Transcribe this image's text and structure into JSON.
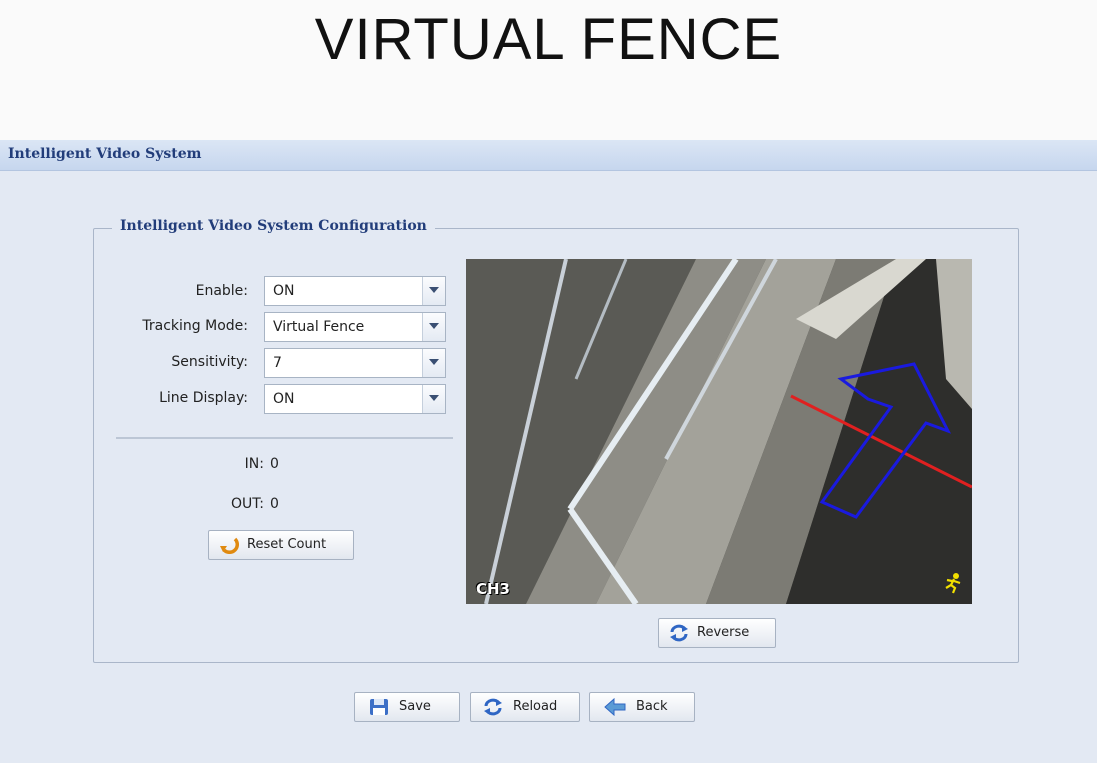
{
  "banner": {
    "title": "VIRTUAL FENCE"
  },
  "app": {
    "title": "Intelligent Video System"
  },
  "config": {
    "legend": "Intelligent Video System Configuration",
    "fields": [
      {
        "label": "Enable:",
        "value": "ON"
      },
      {
        "label": "Tracking Mode:",
        "value": "Virtual Fence"
      },
      {
        "label": "Sensitivity:",
        "value": "7"
      },
      {
        "label": "Line Display:",
        "value": "ON"
      }
    ],
    "counts": {
      "in_label": "IN:",
      "in_value": "0",
      "out_label": "OUT:",
      "out_value": "0"
    },
    "reset_label": "Reset Count"
  },
  "video": {
    "channel": "CH3",
    "reverse_label": "Reverse"
  },
  "actions": {
    "save_label": "Save",
    "reload_label": "Reload",
    "back_label": "Back"
  },
  "icons": [
    "reset-arrow-icon",
    "refresh-icon",
    "save-disk-icon",
    "back-arrow-icon",
    "running-person-icon"
  ],
  "colors": {
    "title_blue": "#223d7a",
    "fence_line": "#e02020",
    "direction_arrow": "#1a1adf"
  }
}
